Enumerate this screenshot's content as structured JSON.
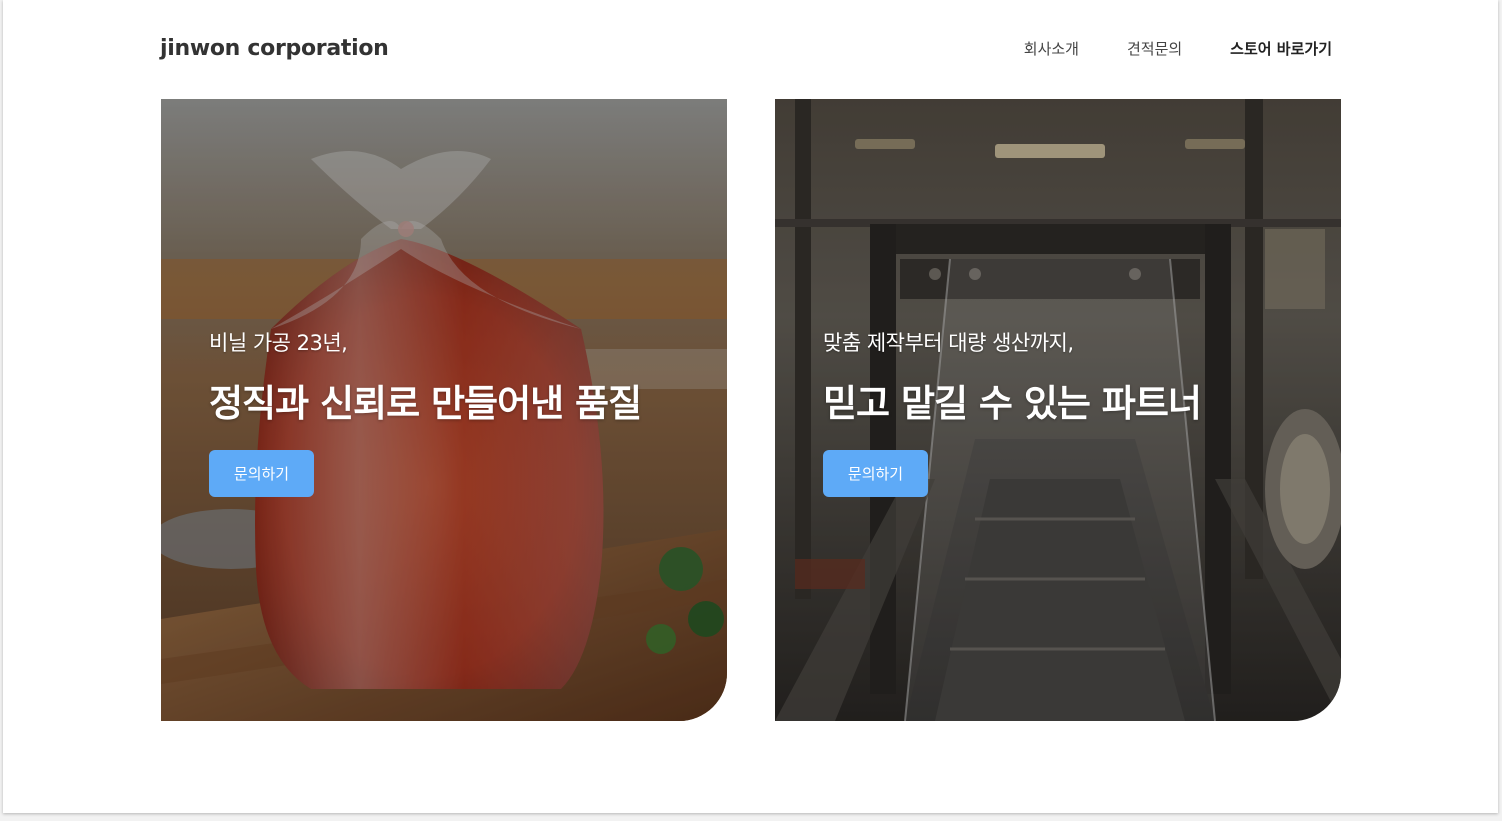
{
  "brand": {
    "logo": "jinwon corporation"
  },
  "nav": [
    {
      "label": "회사소개"
    },
    {
      "label": "견적문의"
    },
    {
      "label": "스토어 바로가기"
    }
  ],
  "cards": [
    {
      "subtitle": "비닐 가공 23년,",
      "title": "정직과 신뢰로 만들어낸 품질",
      "button": "문의하기",
      "image": "kimchi-in-plastic-bag-photo"
    },
    {
      "subtitle": "맞춤 제작부터 대량 생산까지,",
      "title": "믿고 맡길 수 있는 파트너",
      "button": "문의하기",
      "image": "factory-machine-photo"
    }
  ],
  "colors": {
    "accent": "#5eaaf7",
    "text": "#333333",
    "background": "#ffffff"
  }
}
